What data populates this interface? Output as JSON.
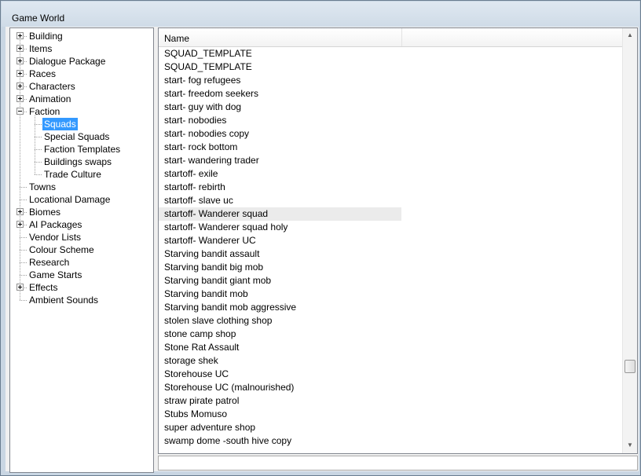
{
  "window": {
    "title": "Game World"
  },
  "tree": {
    "items": [
      {
        "label": "Building",
        "expander": "plus",
        "level": 0
      },
      {
        "label": "Items",
        "expander": "plus",
        "level": 0
      },
      {
        "label": "Dialogue Package",
        "expander": "plus",
        "level": 0
      },
      {
        "label": "Races",
        "expander": "plus",
        "level": 0
      },
      {
        "label": "Characters",
        "expander": "plus",
        "level": 0
      },
      {
        "label": "Animation",
        "expander": "plus",
        "level": 0
      },
      {
        "label": "Faction",
        "expander": "minus",
        "level": 0
      },
      {
        "label": "Squads",
        "expander": "none",
        "level": 1,
        "selected": true
      },
      {
        "label": "Special Squads",
        "expander": "none",
        "level": 1
      },
      {
        "label": "Faction Templates",
        "expander": "none",
        "level": 1
      },
      {
        "label": "Buildings swaps",
        "expander": "none",
        "level": 1
      },
      {
        "label": "Trade Culture",
        "expander": "none",
        "level": 1
      },
      {
        "label": "Towns",
        "expander": "none",
        "level": 0
      },
      {
        "label": "Locational Damage",
        "expander": "none",
        "level": 0
      },
      {
        "label": "Biomes",
        "expander": "plus",
        "level": 0
      },
      {
        "label": "AI Packages",
        "expander": "plus",
        "level": 0
      },
      {
        "label": "Vendor Lists",
        "expander": "none",
        "level": 0
      },
      {
        "label": "Colour Scheme",
        "expander": "none",
        "level": 0
      },
      {
        "label": "Research",
        "expander": "none",
        "level": 0
      },
      {
        "label": "Game Starts",
        "expander": "none",
        "level": 0
      },
      {
        "label": "Effects",
        "expander": "plus",
        "level": 0
      },
      {
        "label": "Ambient Sounds",
        "expander": "none",
        "level": 0
      }
    ]
  },
  "list": {
    "header": {
      "name": "Name"
    },
    "hover_index": 12,
    "rows": [
      "SQUAD_TEMPLATE",
      "SQUAD_TEMPLATE",
      "start- fog refugees",
      "start- freedom seekers",
      "start- guy with dog",
      "start- nobodies",
      "start- nobodies copy",
      "start- rock bottom",
      "start- wandering trader",
      "startoff- exile",
      "startoff- rebirth",
      "startoff- slave uc",
      "startoff- Wanderer squad",
      "startoff- Wanderer squad holy",
      "startoff- Wanderer UC",
      "Starving bandit assault",
      "Starving bandit big mob",
      "Starving bandit giant mob",
      "Starving bandit mob",
      "Starving bandit mob aggressive",
      "stolen slave clothing shop",
      "stone camp shop",
      "Stone Rat Assault",
      "storage shek",
      "Storehouse UC",
      "Storehouse UC (malnourished)",
      "straw pirate patrol",
      "Stubs Momuso",
      "super adventure shop",
      "swamp dome -south hive copy"
    ]
  },
  "scrollbar": {
    "up_icon": "arrow-up-icon",
    "down_icon": "arrow-down-icon",
    "up_glyph": "▲",
    "down_glyph": "▼",
    "position": 0.83
  },
  "colors": {
    "selection": "#3399ff",
    "hover_row": "#ebebeb"
  }
}
